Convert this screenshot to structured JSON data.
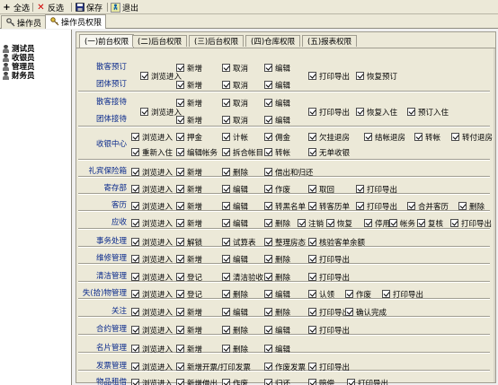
{
  "toolbar": {
    "buttons": [
      {
        "icon": "plus-icon",
        "label": "全选"
      },
      {
        "icon": "x-icon",
        "label": "反选"
      },
      {
        "icon": "floppy-icon",
        "label": "保存"
      },
      {
        "icon": "exit-icon",
        "label": "退出"
      }
    ]
  },
  "tabs": [
    {
      "label": "操作员",
      "active": false
    },
    {
      "label": "操作员权限",
      "active": true
    }
  ],
  "tree": {
    "items": [
      "测试员",
      "收银员",
      "管理员",
      "财务员"
    ]
  },
  "perm_tabs": [
    {
      "label": "(一)前台权限",
      "active": true
    },
    {
      "label": "(二)后台权限",
      "active": false
    },
    {
      "label": "(三)后台权限",
      "active": false
    },
    {
      "label": "(四)仓库权限",
      "active": false
    },
    {
      "label": "(五)报表权限",
      "active": false
    }
  ],
  "rows": [
    {
      "labels": [
        "散客预订",
        "团体预订"
      ],
      "cells": [
        [
          "浏览进入"
        ],
        [
          "新增",
          "新增"
        ],
        [
          "取消",
          "取消"
        ],
        [
          "编辑",
          "编辑"
        ],
        [
          "打印导出"
        ],
        [
          "恢复预订"
        ]
      ]
    },
    {
      "labels": [
        "散客接待",
        "团体接待"
      ],
      "cells": [
        [
          "浏览进入"
        ],
        [
          "新增",
          "新增"
        ],
        [
          "取消",
          "取消"
        ],
        [
          "编辑",
          "编辑"
        ],
        [
          "打印导出"
        ],
        [
          "恢复入住"
        ],
        [
          "预订入住"
        ]
      ]
    },
    {
      "labels": [
        "收银中心"
      ],
      "cells": [
        [
          "浏览进入",
          "重新入住",
          "押金",
          "编辑帐务",
          "计帐",
          "拆合帐目",
          "佣金",
          "转帐",
          "欠挂退房",
          "无单收银",
          "结帐退房",
          "转帐",
          "转付退房"
        ]
      ]
    },
    {
      "labels": [
        "礼宾保险箱"
      ],
      "cells": [
        [
          "浏览进入",
          "新增",
          "删除",
          "借出和归还"
        ]
      ]
    },
    {
      "labels": [
        "寄存部"
      ],
      "cells": [
        [
          "浏览进入",
          "新增",
          "编辑",
          "作废",
          "取回",
          "打印导出"
        ]
      ]
    },
    {
      "labels": [
        "客历"
      ],
      "cells": [
        [
          "浏览进入",
          "新增",
          "编辑",
          "转黑名单",
          "转客历单",
          "打印导出",
          "合并客历",
          "删除"
        ]
      ]
    },
    {
      "labels": [
        "应收"
      ],
      "cells": [
        [
          "浏览进入",
          "新增",
          "编辑",
          "删除",
          "注销",
          "恢复",
          "停用",
          "帐务",
          "复核",
          "打印导出"
        ]
      ]
    },
    {
      "labels": [
        "事务处理"
      ],
      "cells": [
        [
          "浏览进入",
          "解锁",
          "试算表",
          "整理房态",
          "核验客单余额"
        ]
      ]
    },
    {
      "labels": [
        "维修管理"
      ],
      "cells": [
        [
          "浏览进入",
          "新增",
          "编辑",
          "删除",
          "打印导出"
        ]
      ]
    },
    {
      "labels": [
        "清洁管理"
      ],
      "cells": [
        [
          "浏览进入",
          "登记",
          "清洁验收",
          "删除",
          "打印导出"
        ]
      ]
    },
    {
      "labels": [
        "失(拾)物管理"
      ],
      "cells": [
        [
          "浏览进入",
          "登记",
          "删除",
          "编辑",
          "认领",
          "作废",
          "打印导出"
        ]
      ]
    },
    {
      "labels": [
        "关注"
      ],
      "cells": [
        [
          "浏览进入",
          "新增",
          "编辑",
          "删除",
          "打印导出",
          "确认完成"
        ]
      ]
    },
    {
      "labels": [
        "合约管理"
      ],
      "cells": [
        [
          "浏览进入",
          "新增",
          "删除",
          "编辑",
          "打印导出"
        ]
      ]
    },
    {
      "labels": [
        "名片管理"
      ],
      "cells": [
        [
          "浏览进入",
          "新增",
          "删除",
          "编辑"
        ]
      ]
    },
    {
      "labels": [
        "发票管理"
      ],
      "cells": [
        [
          "浏览进入",
          "新增开票/打印发票",
          "作废发票",
          "打印导出"
        ]
      ]
    },
    {
      "labels": [
        "物品租借"
      ],
      "cells": [
        [
          "浏览进入",
          "新增借出",
          "作废",
          "归还",
          "赔偿",
          "打印导出"
        ]
      ]
    }
  ]
}
